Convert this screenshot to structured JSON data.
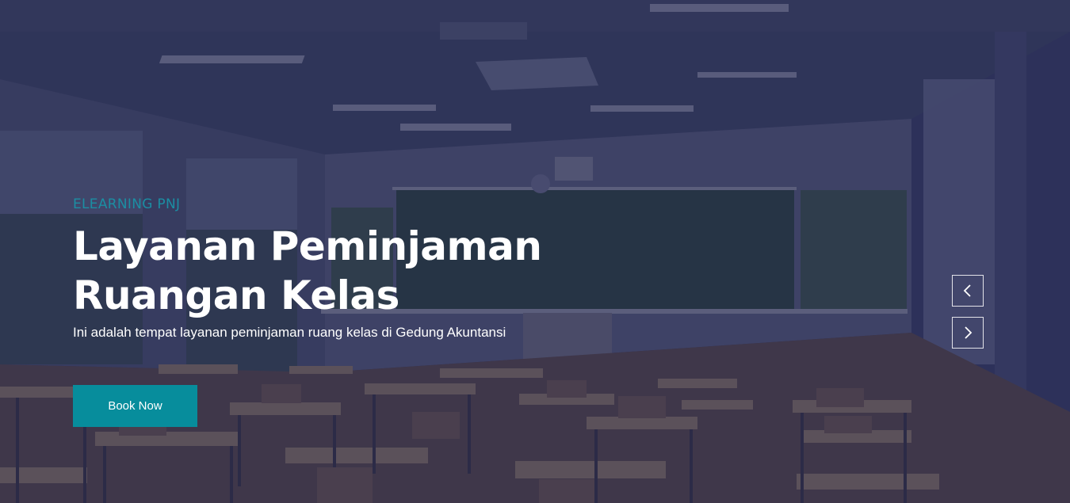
{
  "hero": {
    "eyebrow": "ELEARNING PNJ",
    "title_line1": "Layanan Peminjaman",
    "title_line2": "Ruangan Kelas",
    "subtitle": "Ini adalah tempat layanan peminjaman ruang kelas di Gedung Akuntansi",
    "cta_label": "Book Now"
  },
  "carousel": {
    "prev_icon": "chevron-left-icon",
    "next_icon": "chevron-right-icon"
  },
  "colors": {
    "accent": "#078d9c",
    "eyebrow": "#1b8ea3",
    "overlay": "#1c2046"
  }
}
